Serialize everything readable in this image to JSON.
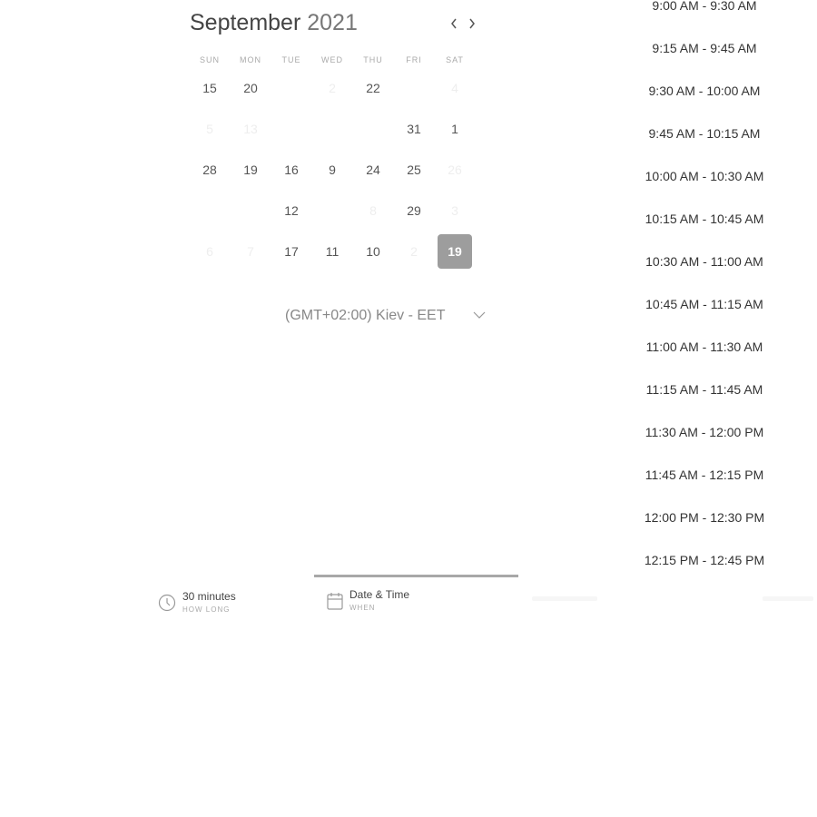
{
  "calendar": {
    "month": "September",
    "year": "2021",
    "prev_icon": "chevron-left-icon",
    "next_icon": "chevron-right-icon",
    "weekdays": [
      "SUN",
      "MON",
      "TUE",
      "WED",
      "THU",
      "FRI",
      "SAT"
    ],
    "weeks": [
      [
        {
          "label": "15",
          "state": "normal"
        },
        {
          "label": "20",
          "state": "normal"
        },
        {
          "label": "",
          "state": "empty"
        },
        {
          "label": "2",
          "state": "faded"
        },
        {
          "label": "22",
          "state": "normal"
        },
        {
          "label": "",
          "state": "empty"
        },
        {
          "label": "4",
          "state": "faded"
        }
      ],
      [
        {
          "label": "5",
          "state": "faded"
        },
        {
          "label": "13",
          "state": "faded"
        },
        {
          "label": "",
          "state": "empty"
        },
        {
          "label": "",
          "state": "empty"
        },
        {
          "label": "",
          "state": "empty"
        },
        {
          "label": "31",
          "state": "normal"
        },
        {
          "label": "1",
          "state": "normal"
        }
      ],
      [
        {
          "label": "28",
          "state": "normal"
        },
        {
          "label": "19",
          "state": "normal"
        },
        {
          "label": "16",
          "state": "normal"
        },
        {
          "label": "9",
          "state": "normal"
        },
        {
          "label": "24",
          "state": "normal"
        },
        {
          "label": "25",
          "state": "normal"
        },
        {
          "label": "26",
          "state": "faded"
        }
      ],
      [
        {
          "label": "",
          "state": "empty"
        },
        {
          "label": "",
          "state": "empty"
        },
        {
          "label": "12",
          "state": "normal"
        },
        {
          "label": "",
          "state": "empty"
        },
        {
          "label": "8",
          "state": "faded"
        },
        {
          "label": "29",
          "state": "normal"
        },
        {
          "label": "3",
          "state": "faded"
        }
      ],
      [
        {
          "label": "6",
          "state": "faded"
        },
        {
          "label": "7",
          "state": "faded"
        },
        {
          "label": "17",
          "state": "normal"
        },
        {
          "label": "11",
          "state": "normal"
        },
        {
          "label": "10",
          "state": "normal"
        },
        {
          "label": "2",
          "state": "faded"
        },
        {
          "label": "19",
          "state": "selected"
        }
      ]
    ]
  },
  "timezone": {
    "label": "(GMT+02:00) Kiev - EET",
    "icon": "chevron-down-icon"
  },
  "time_slots": [
    "9:00 AM - 9:30 AM",
    "9:15 AM - 9:45 AM",
    "9:30 AM - 10:00 AM",
    "9:45 AM - 10:15 AM",
    "10:00 AM - 10:30 AM",
    "10:15 AM - 10:45 AM",
    "10:30 AM - 11:00 AM",
    "10:45 AM - 11:15 AM",
    "11:00 AM - 11:30 AM",
    "11:15 AM - 11:45 AM",
    "11:30 AM - 12:00 PM",
    "11:45 AM - 12:15 PM",
    "12:00 PM - 12:30 PM",
    "12:15 PM - 12:45 PM"
  ],
  "steps": {
    "duration": {
      "value": "30 minutes",
      "caption": "HOW LONG",
      "icon": "clock-icon"
    },
    "date_time": {
      "value": "Date & Time",
      "caption": "WHEN",
      "icon": "calendar-icon"
    }
  },
  "colors": {
    "selected_day": "#9d9d9d",
    "progress": "#a8a8a8"
  }
}
